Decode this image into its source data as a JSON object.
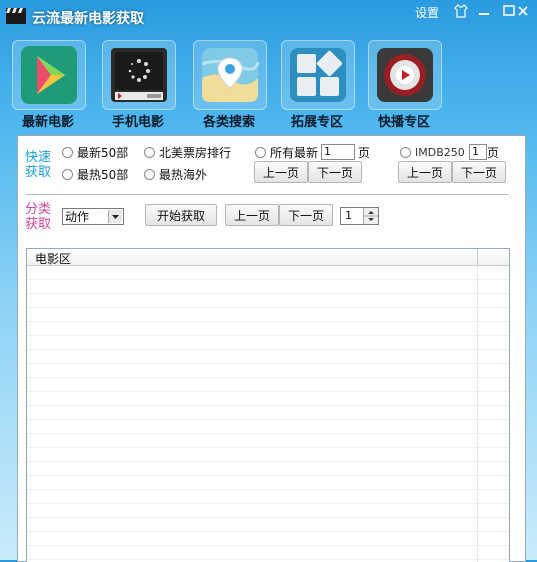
{
  "window": {
    "title": "云流最新电影获取",
    "settings_label": "设置"
  },
  "toolbar": {
    "items": [
      {
        "label": "最新电影"
      },
      {
        "label": "手机电影"
      },
      {
        "label": "各类搜索"
      },
      {
        "label": "拓展专区"
      },
      {
        "label": "快播专区"
      }
    ]
  },
  "quick": {
    "label_top": "快速",
    "label_bottom": "获取",
    "label_color": "#1aa0d8",
    "options": {
      "latest50": "最新50部",
      "hot50": "最热50部",
      "na_boxoffice": "北美票房排行",
      "hot_overseas": "最热海外",
      "all_latest": "所有最新",
      "imdb250": "IMDB250"
    },
    "all_latest_page": "1",
    "imdb_page": "1",
    "page_suffix": "页",
    "prev_label": "上一页",
    "next_label": "下一页"
  },
  "category": {
    "label_top": "分类",
    "label_bottom": "获取",
    "label_color": "#d0479a",
    "selected": "动作",
    "start_label": "开始获取",
    "prev_label": "上一页",
    "next_label": "下一页",
    "page_value": "1"
  },
  "movie_list": {
    "column_header": "电影区"
  },
  "colors": {
    "title_bar_top": "#2a9be0",
    "panel_bg": "#ffffff"
  }
}
